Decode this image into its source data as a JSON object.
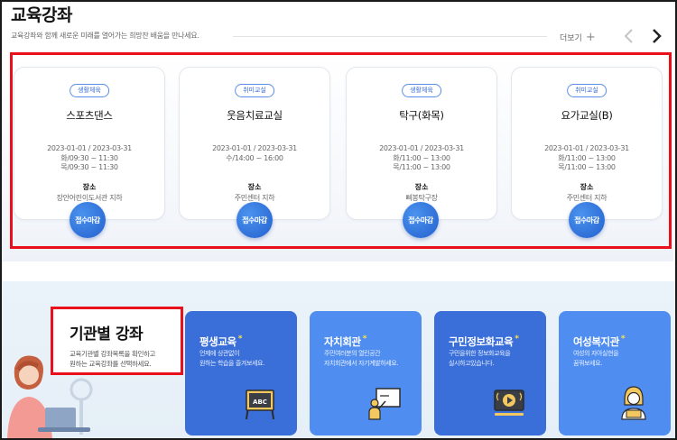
{
  "header": {
    "title": "교육강좌",
    "subtitle": "교육강좌와 함께 새로운 미래를 열어가는 희망찬 배움을 만나세요.",
    "more_label": "더보기",
    "more_icon": "plus-icon",
    "prev_icon": "chevron-left-icon",
    "next_icon": "chevron-right-icon"
  },
  "courses": [
    {
      "category": "생활체육",
      "name": "스포츠댄스",
      "period": "2023-01-01 / 2023-03-31",
      "time1": "화/09:30 ~ 11:30",
      "time2": "목/09:30 ~ 11:30",
      "location_label": "장소",
      "location": "장안어린이도서관 지하",
      "status": "접수마감"
    },
    {
      "category": "취미교실",
      "name": "웃음치료교실",
      "period": "2023-01-01 / 2023-03-31",
      "time1": "수/14:00 ~ 16:00",
      "time2": "",
      "location_label": "장소",
      "location": "주민센터 지하",
      "status": "접수마감"
    },
    {
      "category": "생활체육",
      "name": "탁구(화목)",
      "period": "2023-01-01 / 2023-03-31",
      "time1": "화/11:00 ~ 13:00",
      "time2": "목/11:00 ~ 13:00",
      "location_label": "장소",
      "location": "삐봉탁구장",
      "status": "접수마감"
    },
    {
      "category": "취미교실",
      "name": "요가교실(B)",
      "period": "2023-01-01 / 2023-03-31",
      "time1": "화/11:00 ~ 13:00",
      "time2": "목/11:00 ~ 13:00",
      "location_label": "장소",
      "location": "주민센터 지하",
      "status": "접수마감"
    }
  ],
  "institutions": {
    "title": "기관별 강좌",
    "description_line1": "교육기관별 강좌목록을 확인하고",
    "description_line2": "원하는 교육강좌를 선택하세요.",
    "cards": [
      {
        "title": "평생교육",
        "desc1": "언제에 상관없이",
        "desc2": "원하는 학습을 즐겨보세요.",
        "icon": "abc-board-icon"
      },
      {
        "title": "자치회관",
        "desc1": "주민여러분의 열린공간",
        "desc2": "자치회관에서 자기계발하세요.",
        "icon": "teacher-board-icon"
      },
      {
        "title": "구민정보화교육",
        "desc1": "구민을위한 정보화교육을",
        "desc2": "실시하고있습니다.",
        "icon": "video-play-icon"
      },
      {
        "title": "여성복지관",
        "desc1": "여성의 자아실현을",
        "desc2": "꿈꿔보세요.",
        "icon": "woman-laptop-icon"
      }
    ],
    "star": "*"
  },
  "colors": {
    "accent_blue": "#3a6fd9",
    "light_blue": "#4f8ef0",
    "highlight_red": "#e8111b",
    "star_yellow": "#ffe14a"
  }
}
